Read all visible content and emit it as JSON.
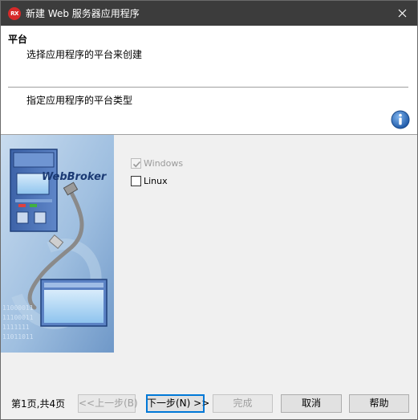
{
  "window": {
    "title": "新建 Web 服务器应用程序",
    "app_icon_text": "RX"
  },
  "header": {
    "title": "平台",
    "subtitle": "选择应用程序的平台来创建",
    "description": "指定应用程序的平台类型"
  },
  "banner": {
    "logo_text": "WebBroker",
    "binary_rows": [
      "11000011",
      "11100011",
      "1111111",
      "11011011"
    ]
  },
  "options": {
    "windows": {
      "label": "Windows",
      "checked": true,
      "disabled": true
    },
    "linux": {
      "label": "Linux",
      "checked": false,
      "disabled": false
    }
  },
  "footer": {
    "page_info": "第1页,共4页",
    "back": "<<上一步(B)",
    "next": "下一步(N) >>",
    "finish": "完成",
    "cancel": "取消",
    "help": "帮助"
  },
  "colors": {
    "titlebar": "#3c3c3c",
    "banner": "#a9c6e4",
    "accent": "#0078d7",
    "icon_red": "#d62a2a",
    "info_blue": "#2d6cc0"
  }
}
